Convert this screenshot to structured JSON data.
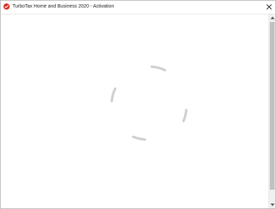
{
  "window": {
    "title": "TurboTax Home and Business 2020 - Activation"
  },
  "icons": {
    "app": "turbotax-check-icon",
    "close": "close-icon",
    "spinner": "loading-spinner-icon"
  },
  "colors": {
    "brand": "#d52b1e",
    "spinner": "#cfcfcf",
    "scroll_thumb": "#c1c1c1"
  }
}
